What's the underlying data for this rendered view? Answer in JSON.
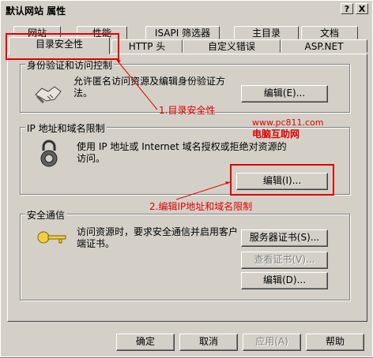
{
  "window": {
    "title": "默认网站 属性",
    "help_button": "?",
    "close_button": "X"
  },
  "tabs_row1": [
    "网站",
    "性能",
    "ISAPI 筛选器",
    "主目录",
    "文档"
  ],
  "tabs_row2": [
    "目录安全性",
    "HTTP 头",
    "自定义错误",
    "ASP.NET"
  ],
  "groups": {
    "auth": {
      "title": "身份验证和访问控制",
      "desc": "允许匿名访问资源及编辑身份验证方法。",
      "button": "编辑(E)..."
    },
    "ip": {
      "title": "IP 地址和域名限制",
      "desc": "使用 IP 地址或 Internet 域名授权或拒绝对资源的访问。",
      "button": "编辑(I)..."
    },
    "secure": {
      "title": "安全通信",
      "desc": "访问资源时，要求安全通信并启用客户端证书。",
      "buttons": [
        "服务器证书(S)...",
        "查看证书(V)...",
        "编辑(D)..."
      ]
    }
  },
  "annotations": {
    "a1": "1.目录安全性",
    "a2": "2.编辑IP地址和域名限制",
    "watermark_url": "www.pc811.com",
    "watermark_name": "电脑互助网"
  },
  "footer": [
    "确定",
    "取消",
    "应用(A)",
    "帮助"
  ]
}
